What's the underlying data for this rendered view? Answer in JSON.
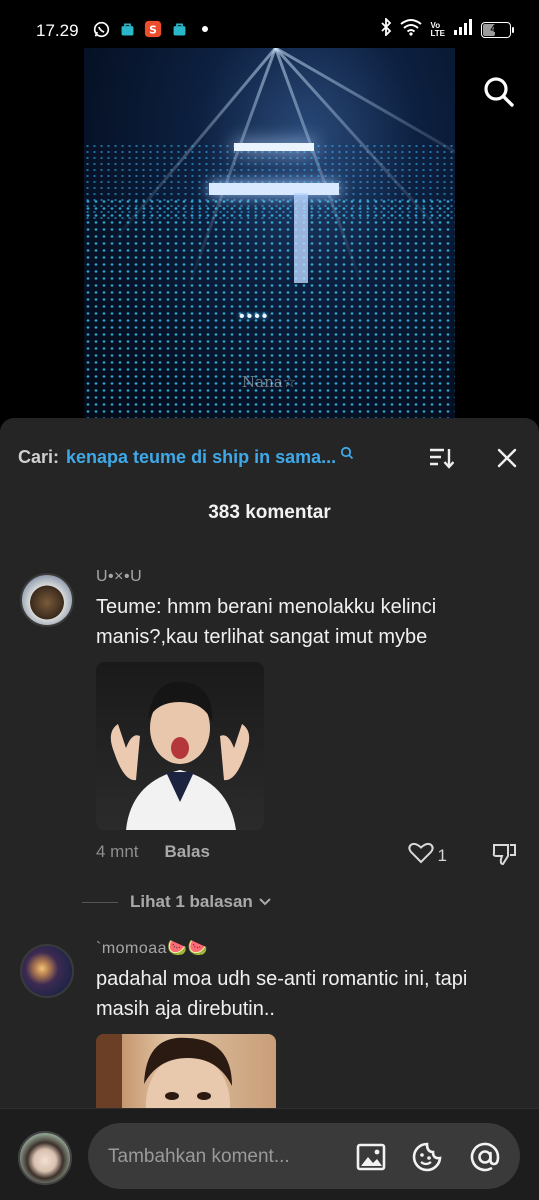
{
  "status_bar": {
    "time": "17.29",
    "battery_level": "48",
    "network_label_top": "Vo",
    "network_label_bottom": "LTE",
    "left_icons": [
      "whatsapp-icon",
      "shop-bag-icon",
      "shopee-icon",
      "shop-bag-icon",
      "dot-icon"
    ],
    "right_icons": [
      "bluetooth-icon",
      "wifi-icon",
      "volte-icon",
      "signal-icon",
      "battery-icon"
    ]
  },
  "video": {
    "watermark": "Nana☆",
    "overlay_glyphs": "•••• ",
    "search_icon": "search-icon"
  },
  "comments_sheet": {
    "search_label": "Cari:",
    "search_query": "kenapa teume di ship in sama...",
    "sort_icon": "sort-icon",
    "close_icon": "close-icon",
    "count_label": "383 komentar",
    "comments": [
      {
        "username": "U•×•U",
        "text": "Teume: hmm berani menolakku kelinci manis?,kau terlihat sangat imut mybe",
        "time": "4 mnt",
        "reply_label": "Balas",
        "likes": "1"
      },
      {
        "username": "`momoaa🍉🍉",
        "text": "padahal moa udh se-anti romantic ini, tapi masih aja direbutin..",
        "time": "",
        "reply_label": "",
        "likes": ""
      }
    ],
    "view_replies_label": "Lihat 1 balasan"
  },
  "composer": {
    "placeholder": "Tambahkan koment...",
    "buttons": [
      "image-icon",
      "emoji-icon",
      "mention-icon"
    ]
  },
  "colors": {
    "sheet_bg": "#252525",
    "accent_blue": "#3fa8e8",
    "text_primary": "#f0f0f0",
    "text_secondary": "#a6a6a6"
  }
}
